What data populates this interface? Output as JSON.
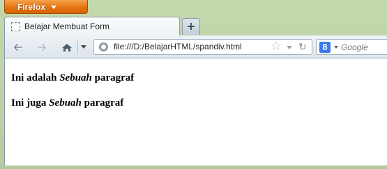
{
  "app_button": {
    "label": "Firefox"
  },
  "tab": {
    "title": "Belajar Membuat Form"
  },
  "new_tab": {
    "label": "+"
  },
  "url": {
    "value": "file:///D:/BelajarHTML/spandiv.html"
  },
  "search": {
    "placeholder": "Google",
    "engine_letter": "8"
  },
  "content": {
    "p1": {
      "before": "Ini adalah ",
      "em": "Sebuah",
      "after": " paragraf"
    },
    "p2": {
      "before": "Ini juga ",
      "em": "Sebuah",
      "after": " paragraf"
    }
  },
  "icons": {
    "back": "back-arrow-icon",
    "forward": "forward-arrow-icon",
    "history": "history-icon",
    "globe": "globe-icon",
    "bookmark": "star-icon",
    "reload": "reload-icon",
    "search_engine": "google-icon"
  }
}
